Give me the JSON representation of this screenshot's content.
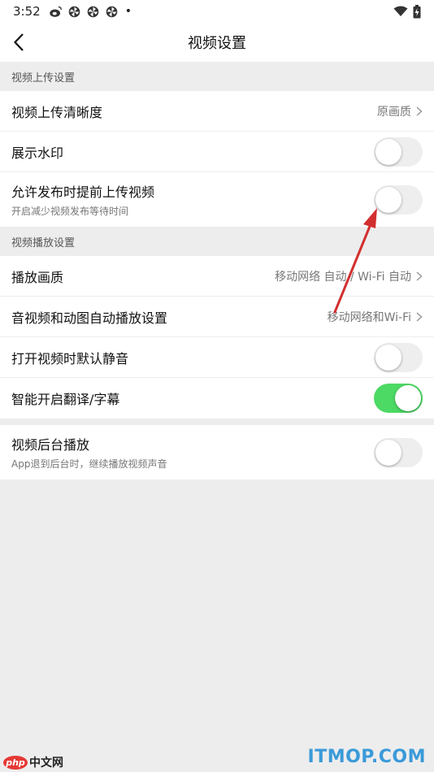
{
  "status_bar": {
    "time": "3:52",
    "icons": [
      "weibo-icon",
      "pinwheel-icon",
      "pinwheel-icon",
      "pinwheel-icon"
    ],
    "dot": "•"
  },
  "nav": {
    "title": "视频设置"
  },
  "sections": {
    "upload_header": "视频上传设置",
    "playback_header": "视频播放设置"
  },
  "rows": {
    "upload_quality": {
      "label": "视频上传清晰度",
      "value": "原画质"
    },
    "watermark": {
      "label": "展示水印",
      "on": false
    },
    "pre_upload": {
      "label": "允许发布时提前上传视频",
      "sublabel": "开启减少视频发布等待时间",
      "on": false
    },
    "playback_quality": {
      "label": "播放画质",
      "value": "移动网络 自动 / Wi-Fi 自动"
    },
    "autoplay": {
      "label": "音视频和动图自动播放设置",
      "value": "移动网络和Wi-Fi"
    },
    "mute_default": {
      "label": "打开视频时默认静音",
      "on": false
    },
    "smart_translate": {
      "label": "智能开启翻译/字幕",
      "on": true
    },
    "background_play": {
      "label": "视频后台播放",
      "sublabel": "App退到后台时，继续播放视频声音",
      "on": false
    }
  },
  "colors": {
    "toggle_on": "#4cd964",
    "toggle_off": "#eeeeee",
    "annotation_arrow": "#d32f2f",
    "watermark_right": "#3a9ad9"
  },
  "watermarks": {
    "left_badge": "php",
    "left_text": "中文网",
    "right_text": "ITMOP.COM"
  }
}
